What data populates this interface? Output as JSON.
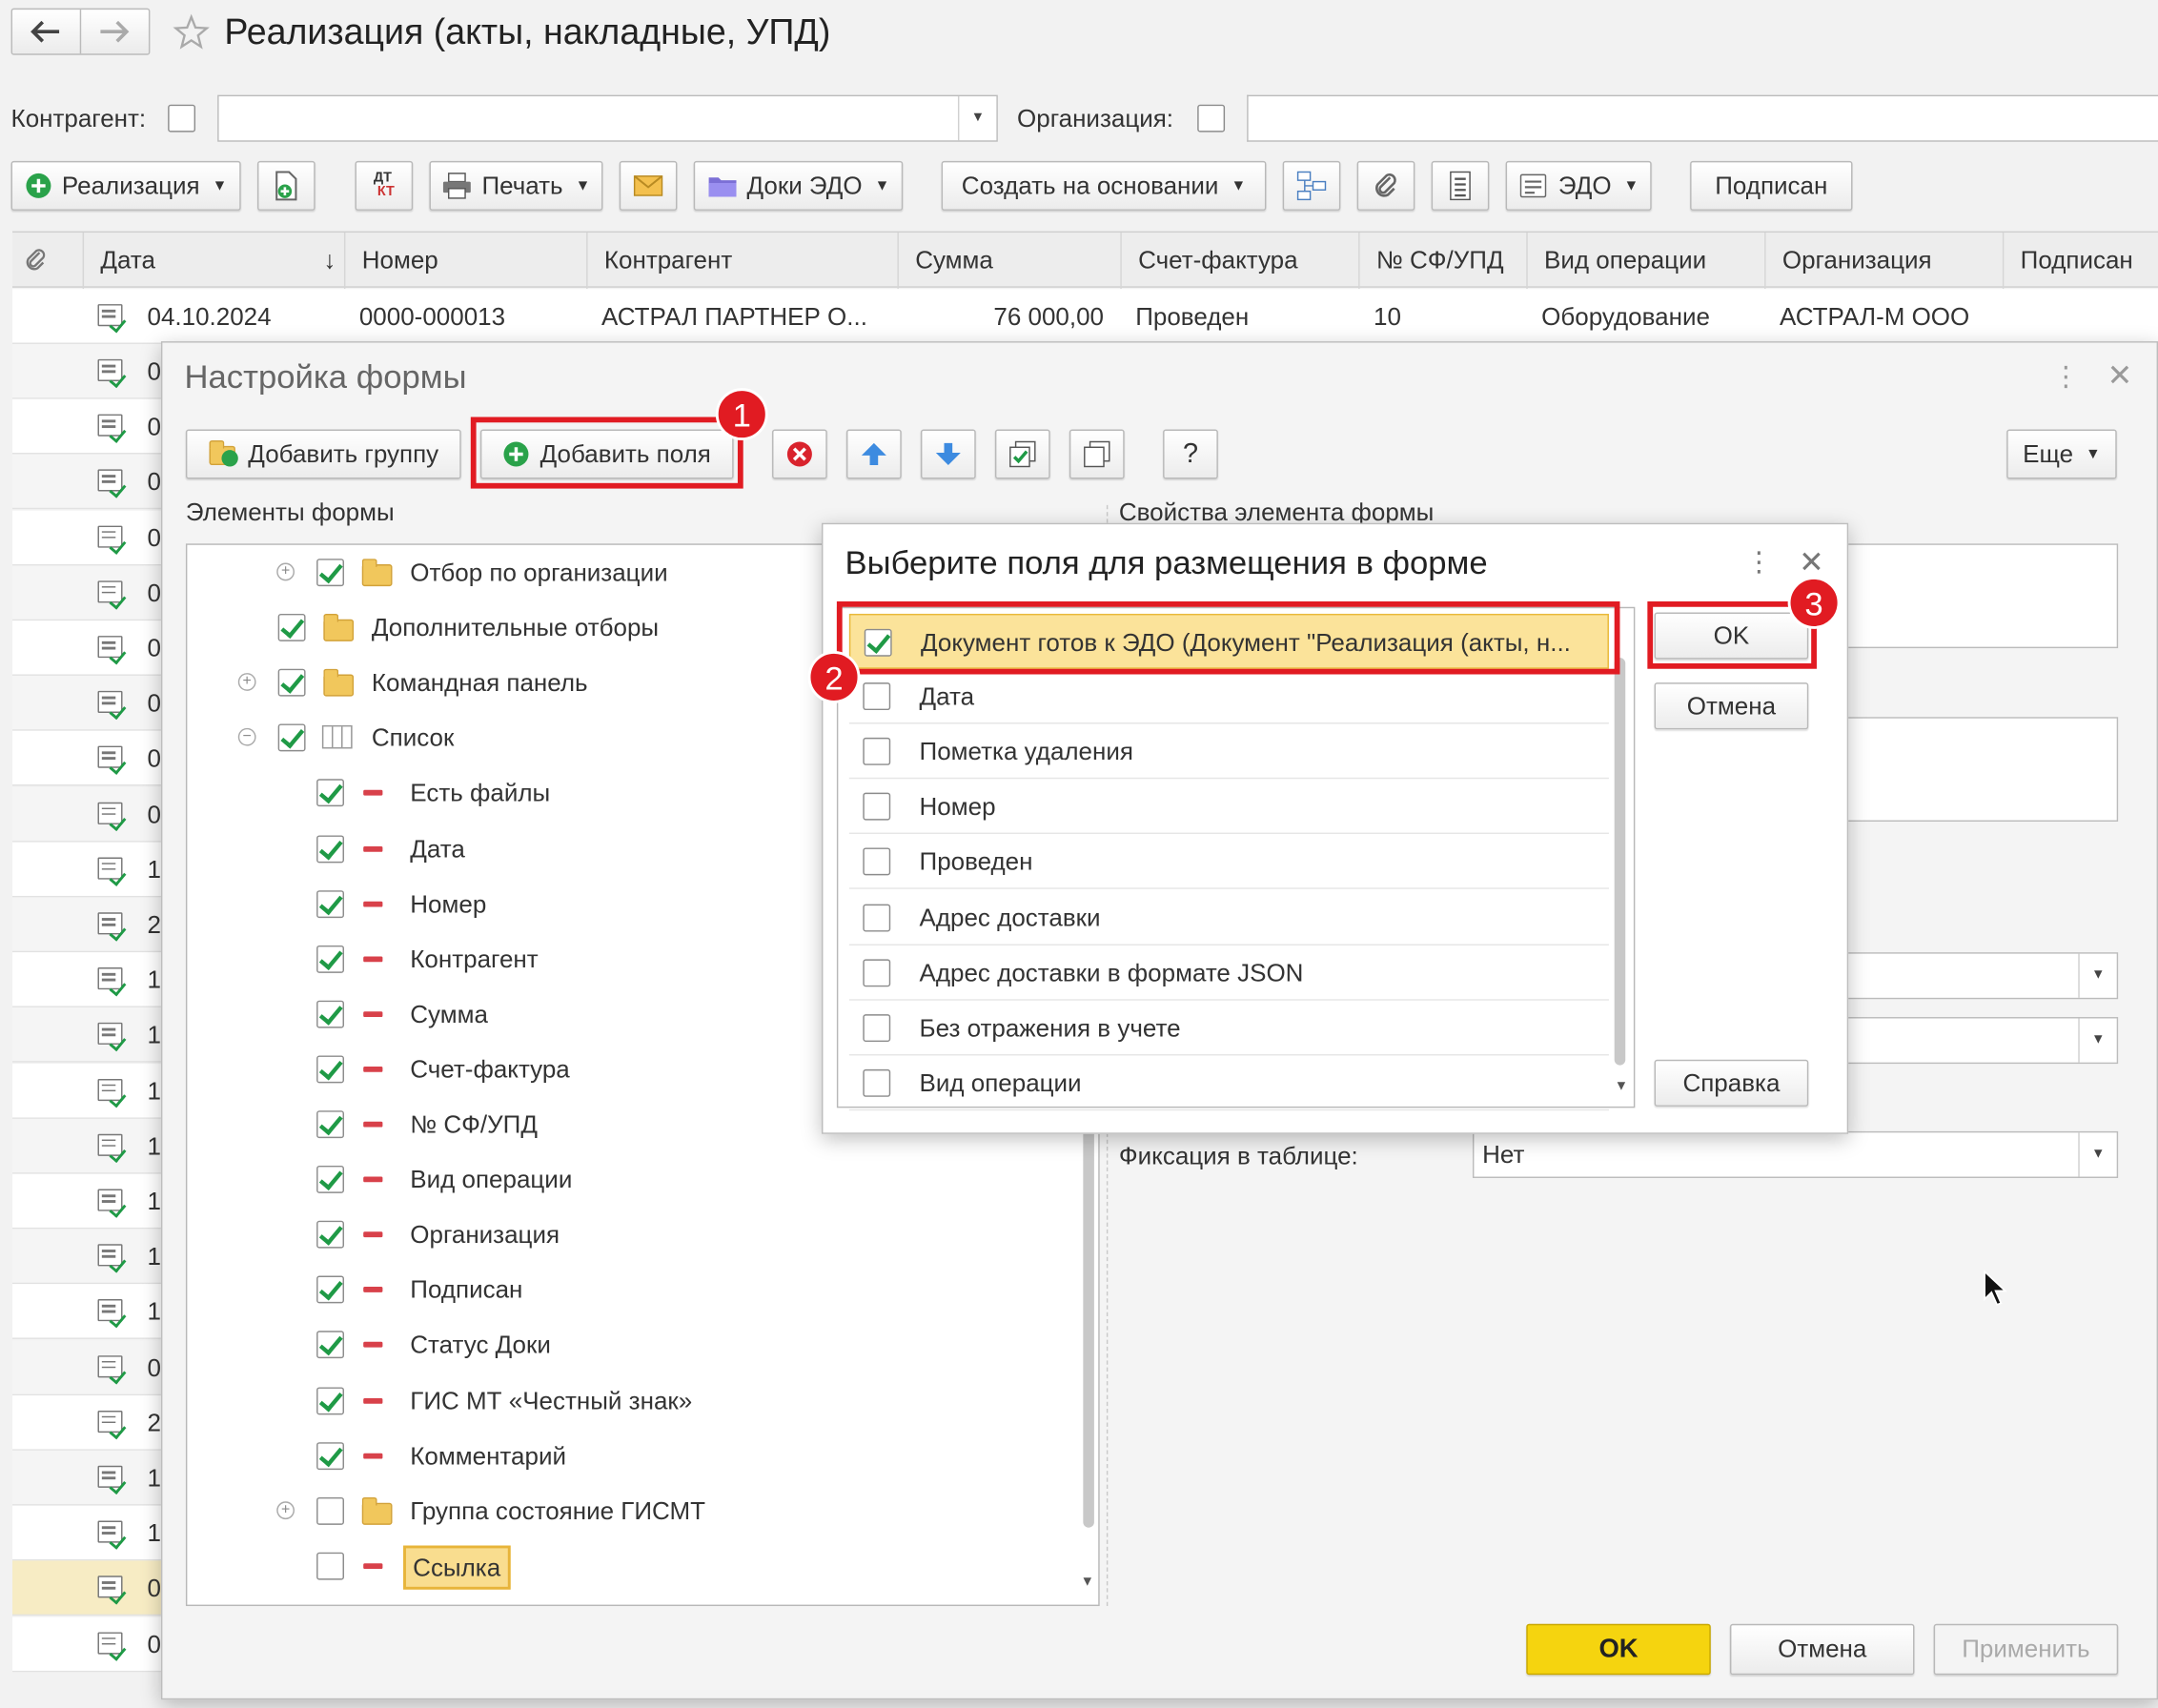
{
  "window": {
    "title": "Реализация (акты, накладные, УПД)"
  },
  "filters": {
    "counterparty_label": "Контрагент:",
    "organization_label": "Организация:"
  },
  "toolbar": {
    "realization": "Реализация",
    "print": "Печать",
    "edo_docs": "Доки ЭДО",
    "create_based": "Создать на основании",
    "edo": "ЭДО",
    "signed": "Подписан"
  },
  "table": {
    "columns": [
      "Дата",
      "Номер",
      "Контрагент",
      "Сумма",
      "Счет-фактура",
      "№ СФ/УПД",
      "Вид операции",
      "Организация",
      "Подписан"
    ],
    "first_row": {
      "date": "04.10.2024",
      "number": "0000-000013",
      "counterparty": "АСТРАЛ ПАРТНЕР О...",
      "sum": "76 000,00",
      "invoice": "Проведен",
      "sf_upd": "10",
      "operation": "Оборудование",
      "organization": "АСТРАЛ-М ООО"
    },
    "row_prefixes": [
      "0",
      "0",
      "0",
      "0",
      "0",
      "0",
      "0",
      "0",
      "0",
      "1",
      "2",
      "1",
      "1",
      "1",
      "1",
      "1",
      "1",
      "1",
      "0",
      "2",
      "1",
      "1",
      "0",
      "0"
    ]
  },
  "form_settings": {
    "title": "Настройка формы",
    "add_group": "Добавить группу",
    "add_fields": "Добавить поля",
    "more": "Еще",
    "help_glyph": "?",
    "elements_label": "Элементы формы",
    "properties_label": "Свойства элемента формы",
    "tree": [
      {
        "label": "Отбор по организации",
        "checked": true,
        "kind": "folder",
        "expand": true,
        "level": 1
      },
      {
        "label": "Дополнительные отборы",
        "checked": true,
        "kind": "folder",
        "expand": false,
        "level": 0
      },
      {
        "label": "Командная панель",
        "checked": true,
        "kind": "folder",
        "expand": true,
        "level": 0
      },
      {
        "label": "Список",
        "checked": true,
        "kind": "table",
        "expand": true,
        "level": 0
      },
      {
        "label": "Есть файлы",
        "checked": true,
        "kind": "field",
        "level": 1
      },
      {
        "label": "Дата",
        "checked": true,
        "kind": "field",
        "level": 1
      },
      {
        "label": "Номер",
        "checked": true,
        "kind": "field",
        "level": 1
      },
      {
        "label": "Контрагент",
        "checked": true,
        "kind": "field",
        "level": 1
      },
      {
        "label": "Сумма",
        "checked": true,
        "kind": "field",
        "level": 1
      },
      {
        "label": "Счет-фактура",
        "checked": true,
        "kind": "field",
        "level": 1
      },
      {
        "label": "№ СФ/УПД",
        "checked": true,
        "kind": "field",
        "level": 1
      },
      {
        "label": "Вид операции",
        "checked": true,
        "kind": "field",
        "level": 1
      },
      {
        "label": "Организация",
        "checked": true,
        "kind": "field",
        "level": 1
      },
      {
        "label": "Подписан",
        "checked": true,
        "kind": "field",
        "level": 1
      },
      {
        "label": "Статус Доки",
        "checked": true,
        "kind": "field",
        "level": 1
      },
      {
        "label": "ГИС МТ «Честный знак»",
        "checked": true,
        "kind": "field",
        "level": 1
      },
      {
        "label": "Комментарий",
        "checked": true,
        "kind": "field",
        "level": 1
      },
      {
        "label": "Группа состояние ГИСМТ",
        "checked": false,
        "kind": "folder",
        "expand": true,
        "level": 1
      },
      {
        "label": "Ссылка",
        "checked": false,
        "kind": "field",
        "level": 1,
        "selected": true
      }
    ],
    "fixation_label": "Фиксация в таблице:",
    "fixation_value": "Нет",
    "ok": "OK",
    "cancel": "Отмена",
    "apply": "Применить"
  },
  "choose_fields": {
    "title": "Выберите поля для размещения в форме",
    "items": [
      {
        "label": "Документ готов к ЭДО (Документ \"Реализация (акты, н...",
        "checked": true
      },
      {
        "label": "Дата",
        "checked": false
      },
      {
        "label": "Пометка удаления",
        "checked": false
      },
      {
        "label": "Номер",
        "checked": false
      },
      {
        "label": "Проведен",
        "checked": false
      },
      {
        "label": "Адрес доставки",
        "checked": false
      },
      {
        "label": "Адрес доставки в формате JSON",
        "checked": false
      },
      {
        "label": "Без отражения в учете",
        "checked": false
      },
      {
        "label": "Вид операции",
        "checked": false
      }
    ],
    "ok": "OK",
    "cancel": "Отмена",
    "help": "Справка"
  },
  "annotations": [
    "1",
    "2",
    "3"
  ],
  "colors": {
    "accent_red": "#e11b22",
    "ok_yellow": "#f5d40f",
    "check_green": "#1f9a46"
  }
}
